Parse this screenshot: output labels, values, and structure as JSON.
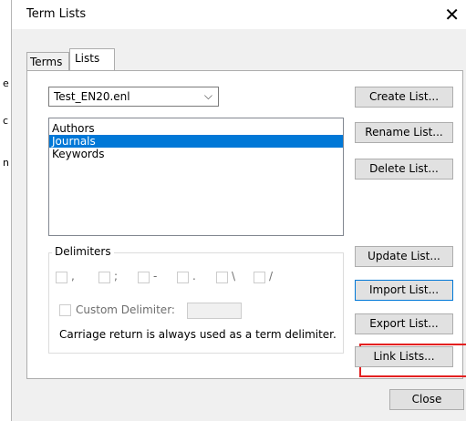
{
  "window": {
    "title": "Term Lists"
  },
  "tabs": [
    {
      "label": "Terms"
    },
    {
      "label": "Lists"
    }
  ],
  "background_fragments": [
    "e",
    "c",
    "n"
  ],
  "library_select": {
    "value": "Test_EN20.enl"
  },
  "lists": [
    {
      "label": "Authors"
    },
    {
      "label": "Journals"
    },
    {
      "label": "Keywords"
    }
  ],
  "selected_list": "Journals",
  "buttons": {
    "create": "Create List...",
    "rename": "Rename List...",
    "delete": "Delete List...",
    "update": "Update List...",
    "import": "Import List...",
    "export": "Export List...",
    "link": "Link Lists...",
    "close": "Close"
  },
  "delimiters": {
    "group_label": "Delimiters",
    "options": [
      {
        "label": ",",
        "checked": false
      },
      {
        "label": ";",
        "checked": false
      },
      {
        "label": "-",
        "checked": false
      },
      {
        "label": ".",
        "checked": false
      },
      {
        "label": "\\",
        "checked": false
      },
      {
        "label": "/",
        "checked": false
      }
    ],
    "custom_label": "Custom Delimiter:",
    "custom_checked": false,
    "custom_value": "",
    "note": "Carriage return is always used as a term delimiter."
  },
  "colors": {
    "selection": "#0078d7",
    "highlight": "#e32020"
  }
}
